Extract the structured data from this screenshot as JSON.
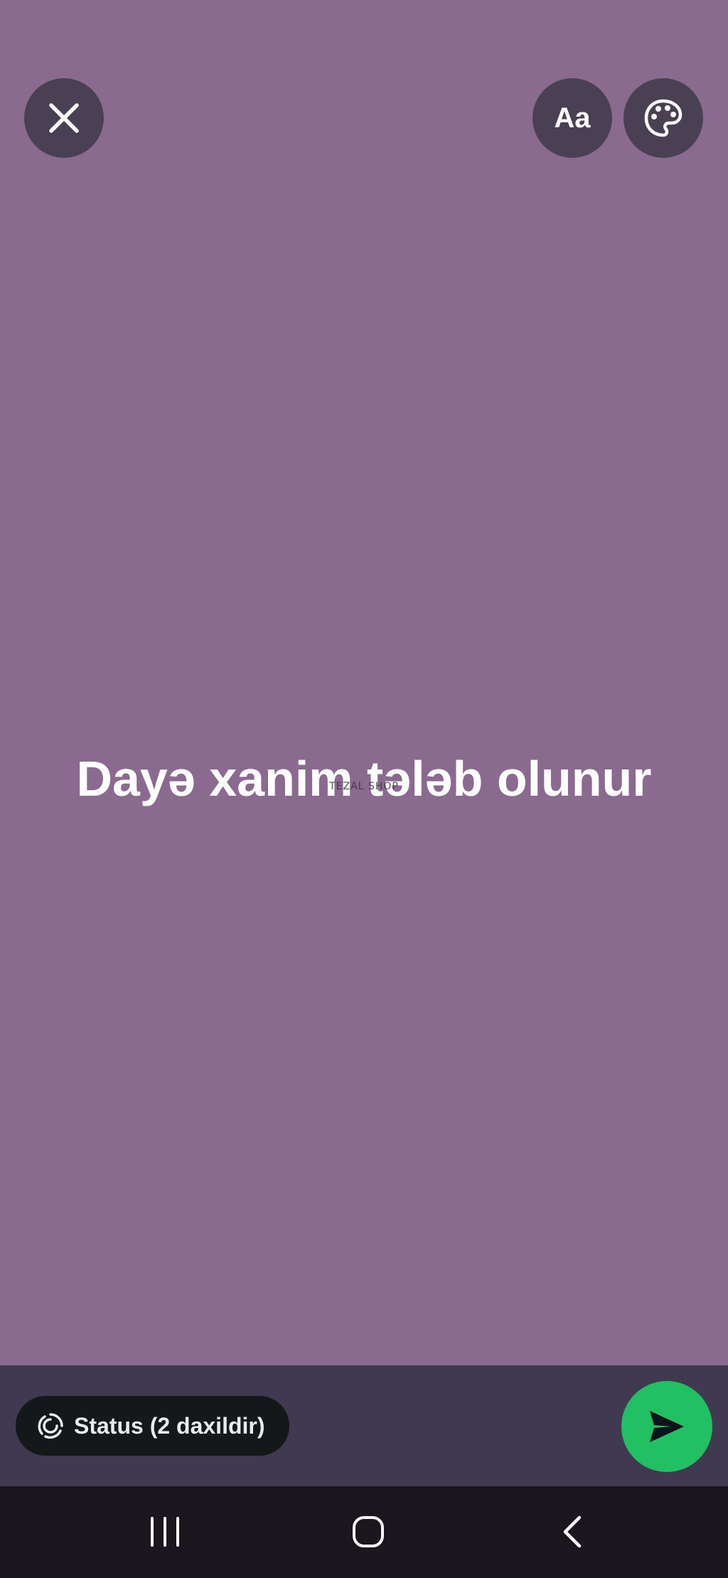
{
  "status": {
    "text": "Dayə xanim tələb olunur",
    "watermark": "TEZAL SHOP",
    "background_color": "#8b6a90"
  },
  "top_bar": {
    "close_icon": "close-icon",
    "font_button_label": "Aa",
    "palette_icon": "palette-icon"
  },
  "bottom_bar": {
    "audience_label": "Status (2 daxildir)",
    "audience_icon": "status-ring-icon",
    "send_icon": "send-icon",
    "send_color": "#21c063"
  },
  "navigation": {
    "recents_icon": "recents-icon",
    "home_icon": "home-icon",
    "back_icon": "back-icon"
  }
}
